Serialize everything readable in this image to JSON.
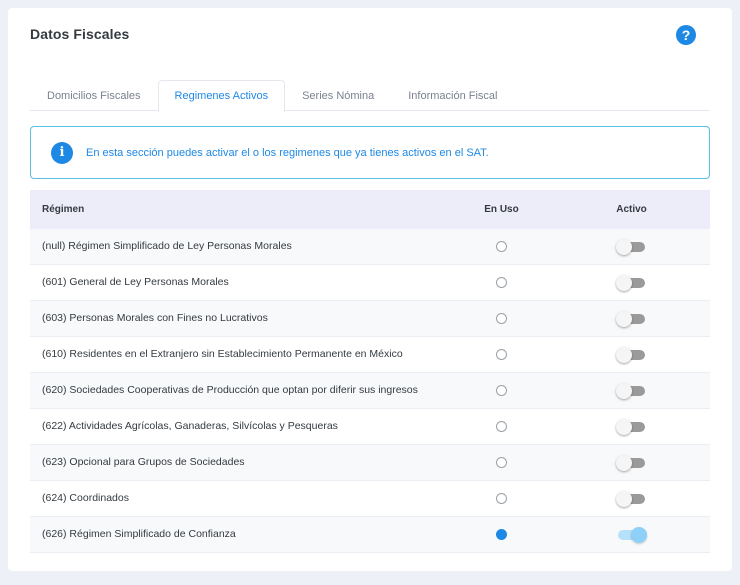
{
  "page": {
    "title": "Datos Fiscales"
  },
  "colors": {
    "accent": "#1e88e5",
    "alert_border": "#5bc0de",
    "header_bg": "#ecedf8"
  },
  "icons": {
    "help": "question-circle-icon",
    "info": "info-circle-icon"
  },
  "tabs": [
    {
      "label": "Domicilios Fiscales",
      "active": false
    },
    {
      "label": "Regimenes Activos",
      "active": true
    },
    {
      "label": "Series Nómina",
      "active": false
    },
    {
      "label": "Información Fiscal",
      "active": false
    }
  ],
  "alert": {
    "text": "En esta sección puedes activar el o los regimenes que ya tienes activos en el SAT."
  },
  "table": {
    "headers": {
      "regimen": "Régimen",
      "en_uso": "En Uso",
      "activo": "Activo"
    },
    "rows": [
      {
        "label": "(null) Régimen Simplificado de Ley Personas Morales",
        "en_uso": false,
        "activo": false
      },
      {
        "label": "(601) General de Ley Personas Morales",
        "en_uso": false,
        "activo": false
      },
      {
        "label": "(603) Personas Morales con Fines no Lucrativos",
        "en_uso": false,
        "activo": false
      },
      {
        "label": "(610) Residentes en el Extranjero sin Establecimiento Permanente en México",
        "en_uso": false,
        "activo": false
      },
      {
        "label": "(620) Sociedades Cooperativas de Producción que optan por diferir sus ingresos",
        "en_uso": false,
        "activo": false
      },
      {
        "label": "(622) Actividades Agrícolas, Ganaderas, Silvícolas y Pesqueras",
        "en_uso": false,
        "activo": false
      },
      {
        "label": "(623) Opcional para Grupos de Sociedades",
        "en_uso": false,
        "activo": false
      },
      {
        "label": "(624) Coordinados",
        "en_uso": false,
        "activo": false
      },
      {
        "label": "(626) Régimen Simplificado de Confianza",
        "en_uso": true,
        "activo": true
      }
    ]
  }
}
